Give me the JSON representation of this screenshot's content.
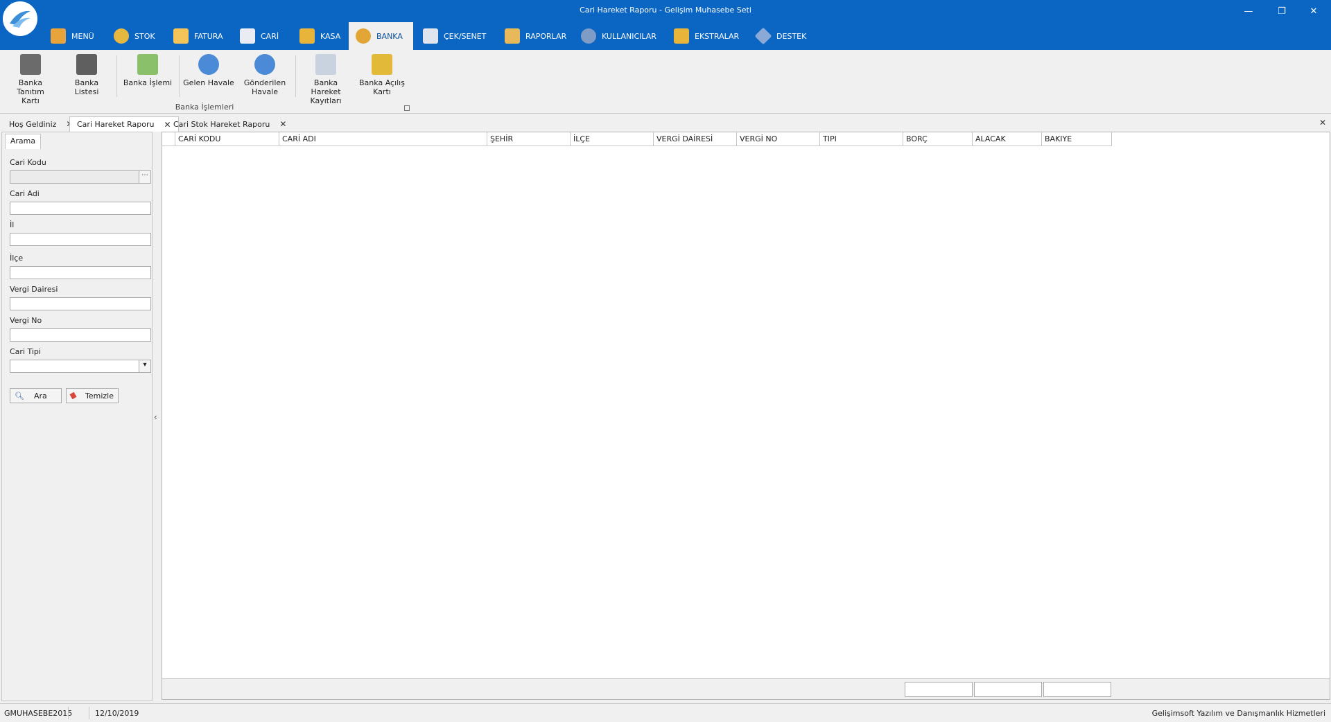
{
  "window": {
    "title": "Cari Hareket Raporu - Gelişim Muhasebe Seti",
    "minimize": "—",
    "restore": "❐",
    "close": "✕"
  },
  "menu_tabs": [
    {
      "label": "MENÜ",
      "icon": "home-icon",
      "color": "#e8a33a"
    },
    {
      "label": "STOK",
      "icon": "stack-icon",
      "color": "#e6b840"
    },
    {
      "label": "FATURA",
      "icon": "invoice-icon",
      "color": "#f2c45a"
    },
    {
      "label": "CARİ",
      "icon": "contact-card-icon",
      "color": "#e9edf3"
    },
    {
      "label": "KASA",
      "icon": "cashbox-icon",
      "color": "#e8b53a"
    },
    {
      "label": "BANKA",
      "icon": "bank-coin-icon",
      "color": "#e1a635"
    },
    {
      "label": "ÇEK/SENET",
      "icon": "document-icon",
      "color": "#dfe5ee"
    },
    {
      "label": "RAPORLAR",
      "icon": "clipboard-icon",
      "color": "#e8b95a"
    },
    {
      "label": "KULLANICILAR",
      "icon": "users-icon",
      "color": "#7f9cc6"
    },
    {
      "label": "EKSTRALAR",
      "icon": "jar-icon",
      "color": "#e8b53a"
    },
    {
      "label": "DESTEK",
      "icon": "tag-icon",
      "color": "#8aa9d6"
    }
  ],
  "ribbon": {
    "group_label": "Banka İşlemleri",
    "buttons": [
      {
        "line1": "Banka Tanıtım",
        "line2": "Kartı",
        "icon": "bank-card-icon",
        "color": "#6b6b6b"
      },
      {
        "line1": "Banka Listesi",
        "line2": "",
        "icon": "bank-list-icon",
        "color": "#5f5f5f"
      },
      {
        "line1": "Banka İşlemi",
        "line2": "",
        "icon": "money-icon",
        "color": "#8ac06a"
      },
      {
        "line1": "Gelen Havale",
        "line2": "",
        "icon": "incoming-transfer-icon",
        "color": "#4b8ad6"
      },
      {
        "line1": "Gönderilen",
        "line2": "Havale",
        "icon": "outgoing-transfer-icon",
        "color": "#4b8ad6"
      },
      {
        "line1": "Banka Hareket",
        "line2": "Kayıtları",
        "icon": "bank-records-icon",
        "color": "#c9d3e0"
      },
      {
        "line1": "Banka Açılış",
        "line2": "Kartı",
        "icon": "bank-opening-icon",
        "color": "#e3b93a"
      }
    ]
  },
  "doc_tabs": [
    {
      "label": "Hoş Geldiniz"
    },
    {
      "label": "Cari Hareket Raporu"
    },
    {
      "label": "Cari Stok Hareket Raporu"
    }
  ],
  "search_panel": {
    "tab": "Arama",
    "fields": {
      "cari_kodu": {
        "label": "Cari Kodu",
        "value": ""
      },
      "cari_adi": {
        "label": "Cari Adi",
        "value": ""
      },
      "il": {
        "label": "İl",
        "value": ""
      },
      "ilce": {
        "label": "İlçe",
        "value": ""
      },
      "vergi_dairesi": {
        "label": "Vergi Dairesi",
        "value": ""
      },
      "vergi_no": {
        "label": "Vergi No",
        "value": ""
      },
      "cari_tipi": {
        "label": "Cari Tipi",
        "value": ""
      }
    },
    "search_button": "Ara",
    "clear_button": "Temizle"
  },
  "grid": {
    "columns": [
      "CARİ KODU",
      "CARİ ADI",
      "ŞEHİR",
      "İLÇE",
      "VERGİ DAİRESİ",
      "VERGİ NO",
      "TIPI",
      "BORÇ",
      "ALACAK",
      "BAKIYE"
    ],
    "rows": []
  },
  "status_bar": {
    "db": "GMUHASEBE2015",
    "date": "12/10/2019",
    "company": "Gelişimsoft Yazılım ve Danışmanlık Hizmetleri"
  }
}
